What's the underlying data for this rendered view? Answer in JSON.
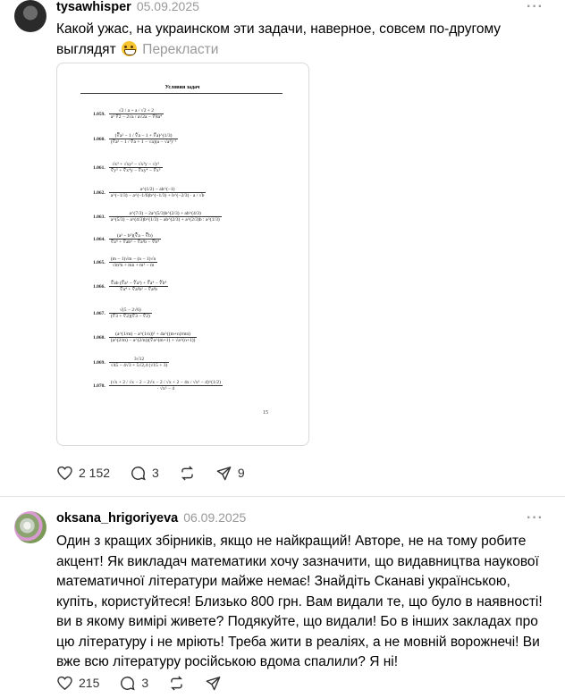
{
  "posts": [
    {
      "username": "tysawhisper",
      "date": "05.09.2025",
      "more": "···",
      "text": "Какой ужас, на украинском эти задачи, наверное, совсем по-другому выглядят",
      "translate": "Перекласти",
      "media": {
        "page_title": "Условия задач",
        "problems": [
          {
            "num": "1.059.",
            "num_expr": "√2 / a + a / √2 + 2",
            "den_expr": "a² ∜2 − 2√a / a√2a − ∜8a⁴"
          },
          {
            "num": "1.060.",
            "num_expr": "(∛a² − 1 / ∜a − 1 + ∜a)^(1/3)",
            "den_expr": "(∛a² − 1 / ∜a + 1 − √a)(a − √a³)⁻¹"
          },
          {
            "num": "1.061.",
            "num_expr": "√x³ + √xy² − √x²y − √y³",
            "den_expr": "∜y⁵ + ∜x⁴y − ∜xy⁴ − ∜x⁵"
          },
          {
            "num": "1.062.",
            "num_expr": "a^(1/2) − ab^(−1)",
            "den_expr": "a^(−1/3) − a^(−1/6)b^(−1/3) + b^(−2/3) · a / √b"
          },
          {
            "num": "1.063.",
            "num_expr": "a^(7/3) − 2a^(5/3)b^(2/3) + ab^(4/3)",
            "den_expr": "a^(5/3) − a^(4/3)b^(1/3) − ab^(2/3) + a^(2/3)b : a^(1/3)"
          },
          {
            "num": "1.064.",
            "num_expr": "(a² − b²)(∛a − ∛b)",
            "den_expr": "∛a⁴ + ∛ab³ − ∛a³b − ∛b⁴"
          },
          {
            "num": "1.065.",
            "num_expr": "(m − 1)√m − (n − 1)√n",
            "den_expr": "√m³n + mn + m² − m"
          },
          {
            "num": "1.066.",
            "num_expr": "∜ab (∜a³ − ∜a³) + ∜a⁴ − ∜b⁴",
            "den_expr": "∜a⁴ + ∜a²b² − ∜a³b"
          },
          {
            "num": "1.067.",
            "num_expr": "√(5 − 2√6)",
            "den_expr": "(∜3 + ∜2)(∜3 − ∜2)"
          },
          {
            "num": "1.068.",
            "num_expr": "(a^(1/m) − a^(1/n))² + 4a^((m+n)/mn)",
            "den_expr": "(a^(2/m) − a^(2/n))(∛a^(m+1) + √a^(n+1))"
          },
          {
            "num": "1.069.",
            "num_expr": "3√12",
            "den_expr": "√45 − 4√3 + 5√2,4 (√15 + 3)"
          },
          {
            "num": "1.070.",
            "num_expr": "(√x + 2 / √x − 2 − 2√x − 2 / √x + 2 − 4x / √x² − 4)^(1/2)",
            "den_expr": "· √x² − 4"
          }
        ],
        "page_number": "15"
      },
      "likes": "2 152",
      "comments": "3",
      "shares": "9"
    },
    {
      "username": "oksana_hrigoriyeva",
      "date": "06.09.2025",
      "more": "···",
      "text": "Один з кращих збірників, якщо не найкращий! Авторе, не на тому робите акцент! Як викладач математики хочу зазначити, що видавництва наукової математичної літератури майже немає! Знайдіть Сканаві українською, купіть, користуйтеся! Близько 800 грн. Вам видали те, що було в наявності! ви в якому вимірі живете? Подякуйте, що видали! Бо в інших закладах про цю літературу і не мріють! Треба жити в реаліях, а не мовній ворожнечі! Ви вже всю літературу російською вдома спалили? Я ні!",
      "likes": "215",
      "comments": "3"
    }
  ],
  "colors": {
    "muted": "#999999",
    "divider": "#e4e4e4",
    "icon": "#333333"
  }
}
